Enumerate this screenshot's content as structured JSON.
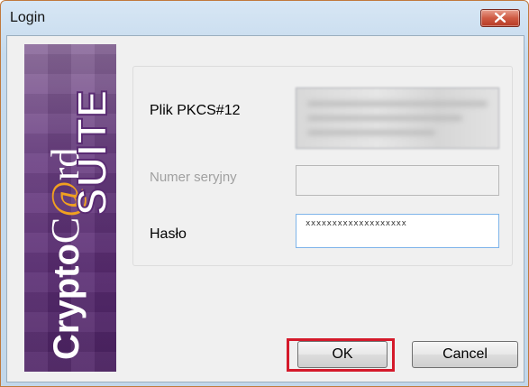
{
  "window": {
    "title": "Login"
  },
  "banner": {
    "brand_crypto": "Crypto",
    "brand_c": "C",
    "brand_at": "@",
    "brand_rd": "rd",
    "brand_suite": "SUITE"
  },
  "form": {
    "pkcs_label": "Plik PKCS#12",
    "pkcs_value": "",
    "serial_label": "Numer seryjny",
    "serial_value": "",
    "password_label": "Hasło",
    "password_value": "xxxxxxxxxxxxxxxxxxx"
  },
  "buttons": {
    "ok": "OK",
    "cancel": "Cancel"
  },
  "colors": {
    "highlight": "#d4192a",
    "banner": "#5a2c73",
    "titlebar": "#c6dbee"
  }
}
